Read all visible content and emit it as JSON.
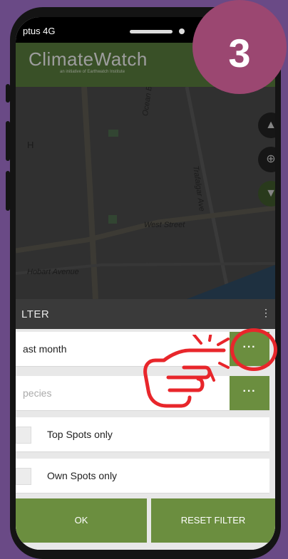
{
  "status_bar": {
    "carrier": "ptus 4G"
  },
  "app": {
    "name": "ClimateWatch",
    "tagline": "an initiative of Earthwatch Institute"
  },
  "map": {
    "street_labels": [
      "Ocean Be",
      "Trafalgar Ave",
      "West Street",
      "Hobart Avenue",
      "H"
    ]
  },
  "filter": {
    "title": "LTER",
    "time_value": "ast month",
    "species_placeholder": "pecies",
    "dots": "···",
    "top_spots_label": "Top Spots only",
    "own_spots_label": "Own Spots only",
    "ok_label": "OK",
    "reset_label": "RESET FILTER"
  },
  "step_badge": "3",
  "colors": {
    "background": "#6a4a86",
    "app_green": "#587b3d",
    "button_green": "#6b8e3f",
    "badge": "#9b4771",
    "highlight_red": "#e8262b"
  },
  "icons": [
    "hand-pointer-icon",
    "location-target-icon",
    "layers-icon",
    "filter-icon",
    "more-icon"
  ]
}
